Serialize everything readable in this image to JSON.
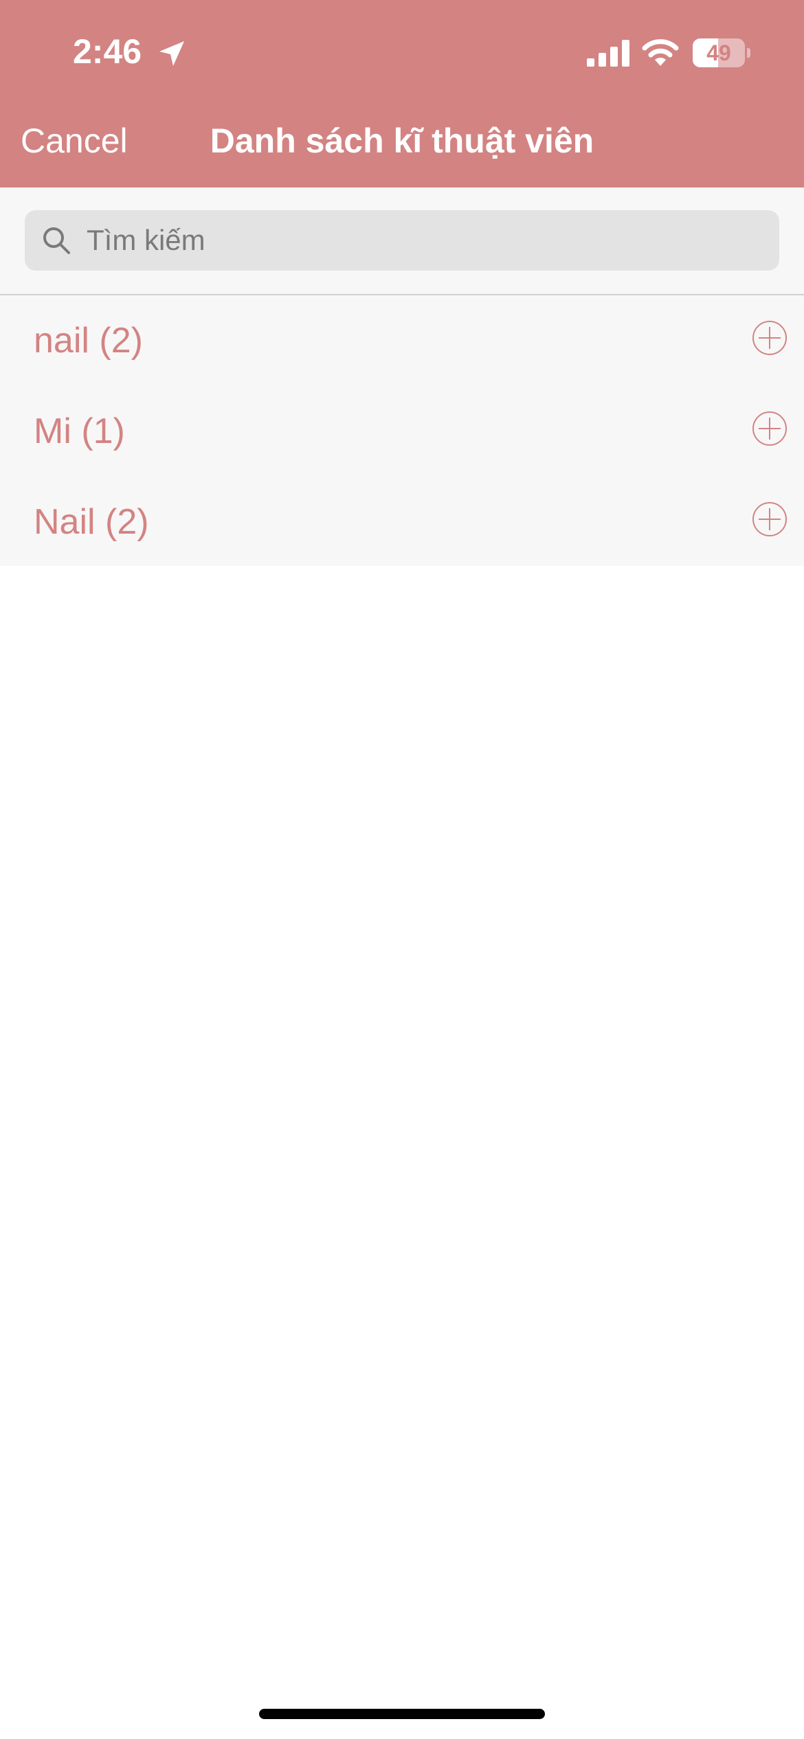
{
  "status_bar": {
    "time": "2:46",
    "battery_level": "49",
    "battery_fraction": 0.49,
    "icons": [
      "location-arrow-icon",
      "cellular-signal-icon",
      "wifi-icon",
      "battery-icon"
    ]
  },
  "nav": {
    "cancel_label": "Cancel",
    "title": "Danh sách kĩ thuật viên"
  },
  "search": {
    "placeholder": "Tìm kiếm",
    "value": ""
  },
  "list": {
    "items": [
      {
        "label": "nail (2)",
        "action_icon": "add-circle-icon"
      },
      {
        "label": "Mi (1)",
        "action_icon": "add-circle-icon"
      },
      {
        "label": "Nail (2)",
        "action_icon": "add-circle-icon"
      }
    ]
  },
  "colors": {
    "accent": "#d48383",
    "header_background": "#d48383",
    "list_background": "#f7f7f7",
    "search_field_background": "#e3e3e3",
    "page_background": "#ffffff"
  }
}
